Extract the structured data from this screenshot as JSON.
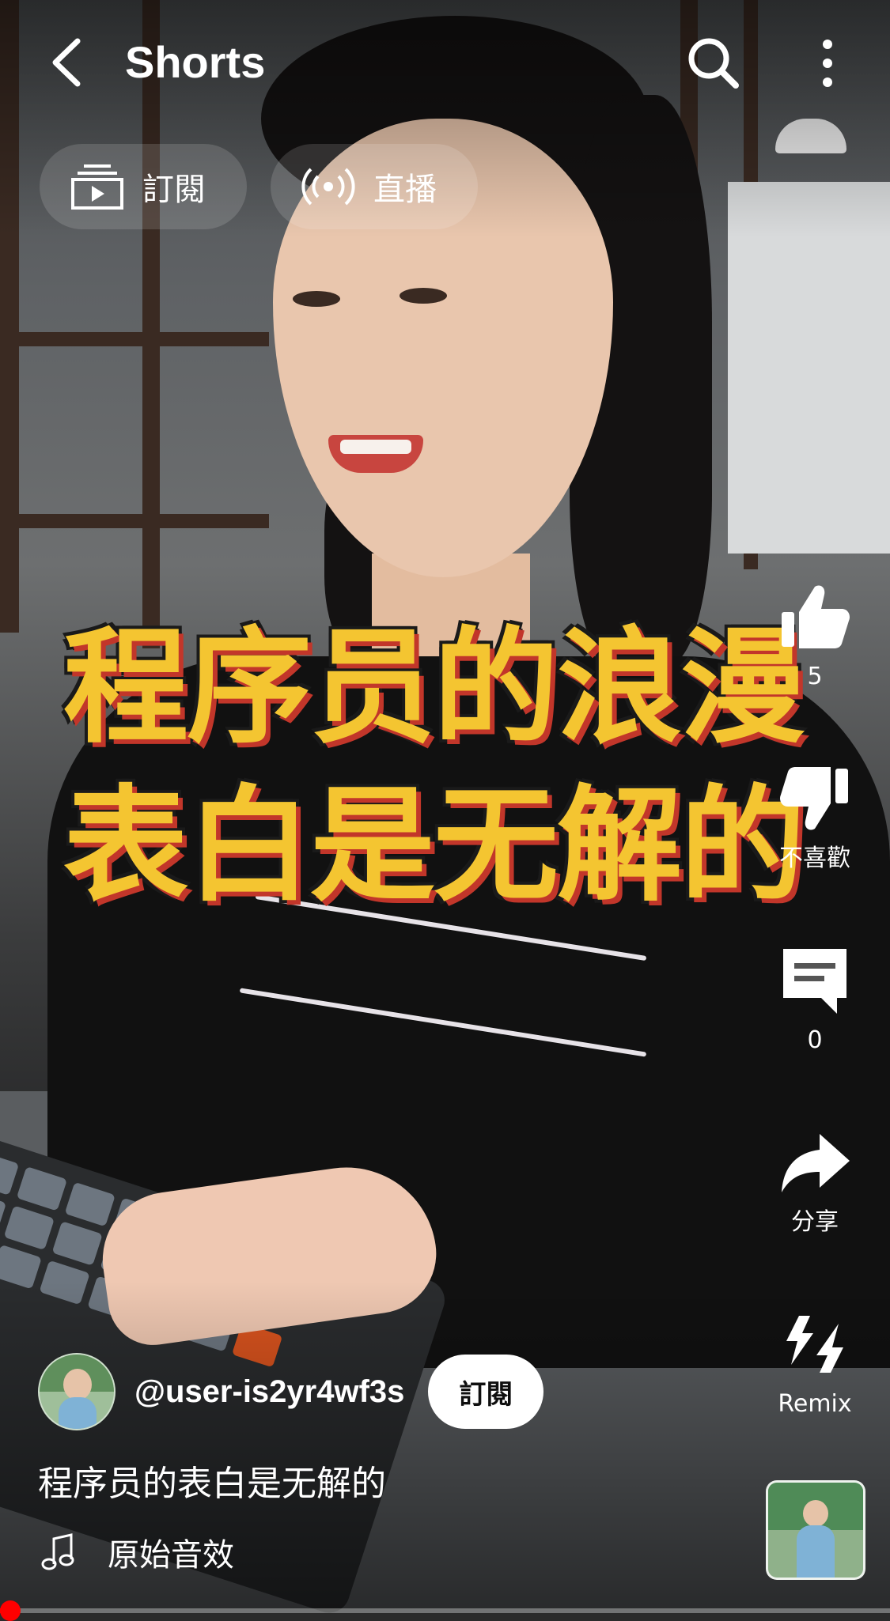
{
  "header": {
    "title": "Shorts"
  },
  "chips": [
    {
      "label": "訂閱",
      "icon": "subscriptions-icon"
    },
    {
      "label": "直播",
      "icon": "live-broadcast-icon"
    }
  ],
  "video": {
    "overlay_text": "程序员的浪漫\n表白是无解的"
  },
  "actions": {
    "like_count": "5",
    "dislike_label": "不喜歡",
    "comment_count": "0",
    "share_label": "分享",
    "remix_label": "Remix"
  },
  "channel": {
    "handle": "@user-is2yr4wf3s",
    "subscribe_label": "訂閱"
  },
  "caption": "程序员的表白是无解的",
  "sound": {
    "label": "原始音效"
  },
  "progress": {
    "fraction": 0.01
  },
  "colors": {
    "overlay_text": "#f4c531",
    "overlay_shadow": "#c2362a",
    "progress": "#ff0000"
  }
}
